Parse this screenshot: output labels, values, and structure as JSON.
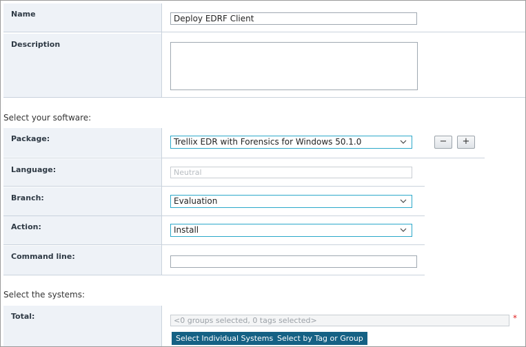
{
  "general": {
    "name_label": "Name",
    "name_value": "Deploy EDRF Client",
    "description_label": "Description",
    "description_value": ""
  },
  "software": {
    "section_title": "Select your software:",
    "package_label": "Package:",
    "package_value": "Trellix EDR with Forensics for Windows 50.1.0",
    "remove_symbol": "−",
    "add_symbol": "+",
    "language_label": "Language:",
    "language_value": "Neutral",
    "branch_label": "Branch:",
    "branch_value": "Evaluation",
    "action_label": "Action:",
    "action_value": "Install",
    "command_line_label": "Command line:",
    "command_line_value": ""
  },
  "systems": {
    "section_title": "Select the systems:",
    "total_label": "Total:",
    "total_value": "<0 groups selected, 0 tags selected>",
    "required_mark": "*",
    "select_individual_label": "Select Individual Systems",
    "select_by_tag_label": "Select by Tag or Group"
  },
  "icons": {
    "dropdown": "chevron-down-icon"
  },
  "colors": {
    "label_bg": "#eef2f7",
    "select_border": "#2aa7c9",
    "primary_button": "#156184",
    "required": "#e02020"
  }
}
